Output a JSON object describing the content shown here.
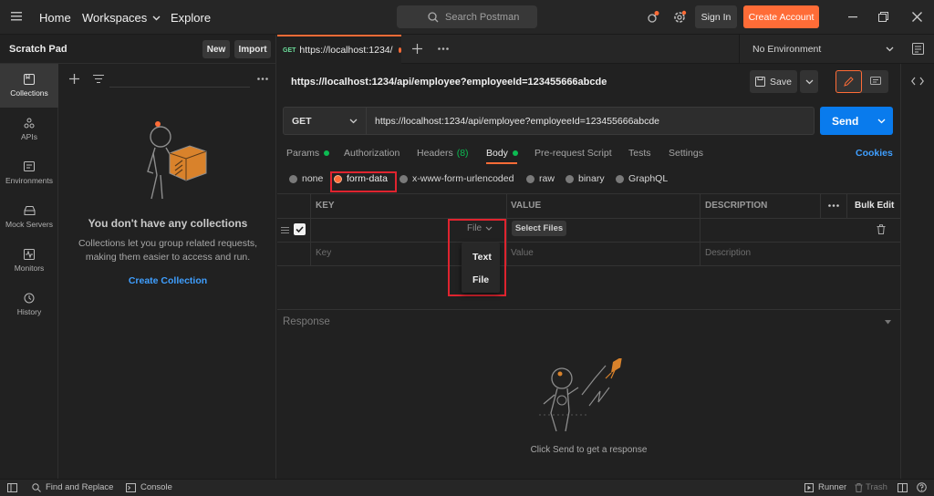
{
  "header": {
    "nav": [
      "Home",
      "Workspaces",
      "Explore"
    ],
    "search_placeholder": "Search Postman",
    "sign_in": "Sign In",
    "create_account": "Create Account"
  },
  "sidebar": {
    "title": "Scratch Pad",
    "new_label": "New",
    "import_label": "Import",
    "rail": [
      "Collections",
      "APIs",
      "Environments",
      "Mock Servers",
      "Monitors",
      "History"
    ],
    "empty_title": "You don't have any collections",
    "empty_desc_1": "Collections let you group related requests,",
    "empty_desc_2": "making them easier to access and run.",
    "create_collection": "Create Collection"
  },
  "tabs": {
    "active_method": "GET",
    "active_label": "https://localhost:1234/",
    "environment": "No Environment"
  },
  "request": {
    "title": "https://localhost:1234/api/employee?employeeId=123455666abcde",
    "save_label": "Save",
    "method": "GET",
    "url": "https://localhost:1234/api/employee?employeeId=123455666abcde",
    "send_label": "Send",
    "subtabs": [
      "Params",
      "Authorization",
      "Headers",
      "(8)",
      "Body",
      "Pre-request Script",
      "Tests",
      "Settings"
    ],
    "cookies": "Cookies",
    "body_types": [
      "none",
      "form-data",
      "x-www-form-urlencoded",
      "raw",
      "binary",
      "GraphQL"
    ],
    "table_headers": [
      "KEY",
      "VALUE",
      "DESCRIPTION"
    ],
    "bulk_edit": "Bulk Edit",
    "file_dropdown": "File",
    "select_files": "Select Files",
    "key_placeholder": "Key",
    "value_placeholder": "Value",
    "description_placeholder": "Description",
    "dropdown_options": [
      "Text",
      "File"
    ]
  },
  "response": {
    "label": "Response",
    "hint": "Click Send to get a response"
  },
  "footer": {
    "find_replace": "Find and Replace",
    "console": "Console",
    "runner": "Runner",
    "trash": "Trash"
  },
  "colors": {
    "accent": "#ff6c37",
    "send": "#097bed",
    "link": "#3f9fff",
    "success_dot": "#0cbb52",
    "highlight_box": "#e0242f"
  }
}
